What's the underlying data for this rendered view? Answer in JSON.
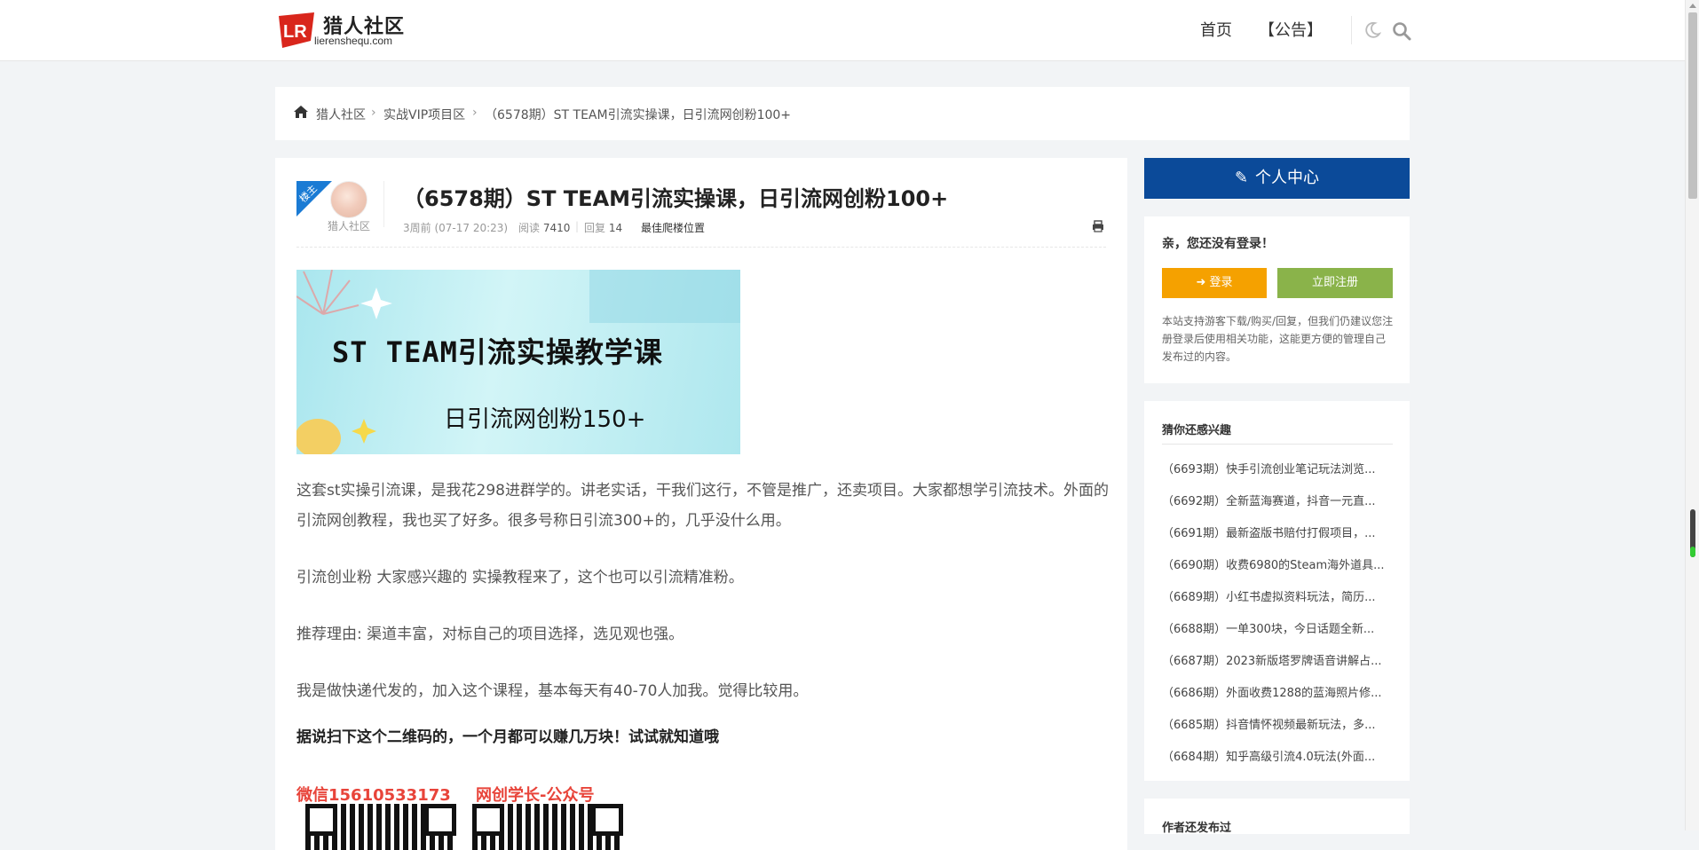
{
  "header": {
    "logo_title": "猎人社区",
    "logo_sub": "lierenshequ.com",
    "logo_mark": "LR",
    "nav": [
      {
        "label": "首页"
      },
      {
        "label": "【公告】"
      }
    ]
  },
  "breadcrumb": {
    "items": [
      "猎人社区",
      "实战VIP项目区",
      "（6578期）ST TEAM引流实操课，日引流网创粉100+"
    ]
  },
  "article": {
    "badge": "楼主",
    "author": "猎人社区",
    "title": "（6578期）ST TEAM引流实操课，日引流网创粉100+",
    "meta_time": "3周前 (07-17 20:23)",
    "meta_read_label": "阅读",
    "meta_read": "7410",
    "meta_reply_label": "回复",
    "meta_reply": "14",
    "meta_floor": "最佳爬楼位置",
    "banner_line1": "ST TEAM引流实操教学课",
    "banner_line2": "日引流网创粉150+",
    "paragraphs": [
      "这套st实操引流课，是我花298进群学的。讲老实话，干我们这行，不管是推广，还卖项目。大家都想学引流技术。外面的引流网创教程，我也买了好多。很多号称日引流300+的，几乎没什么用。",
      "引流创业粉 大家感兴趣的 实操教程来了，这个也可以引流精准粉。",
      "推荐理由: 渠道丰富，对标自己的项目选择，选见观也强。",
      "我是做快递代发的，加入这个课程，基本每天有40-70人加我。觉得比较用。",
      "据说扫下这个二维码的，一个月都可以赚几万块！试试就知道哦"
    ],
    "qr_labels": [
      "微信15610533173",
      "网创学长-公众号"
    ]
  },
  "sidebar": {
    "head": "个人中心",
    "login_title": "亲，您还没有登录！",
    "login_btn": "登录",
    "register_btn": "立即注册",
    "login_note": "本站支持游客下载/购买/回复，但我们仍建议您注册登录后使用相关功能，这能更方便的管理自己发布过的内容。",
    "rec_title": "猜你还感兴趣",
    "rec_items": [
      "（6693期）快手引流创业笔记玩法浏览...",
      "（6692期）全新蓝海赛道，抖音一元直...",
      "（6691期）最新盗版书赔付打假项目，...",
      "（6690期）收费6980的Steam海外道具...",
      "（6689期）小红书虚拟资料玩法，简历...",
      "（6688期）一单300块，今日话题全新...",
      "（6687期）2023新版塔罗牌语音讲解占...",
      "（6686期）外面收费1288的蓝海照片修...",
      "（6685期）抖音情怀视频最新玩法，多...",
      "（6684期）知乎高级引流4.0玩法(外面..."
    ],
    "author_title": "作者还发布过"
  }
}
